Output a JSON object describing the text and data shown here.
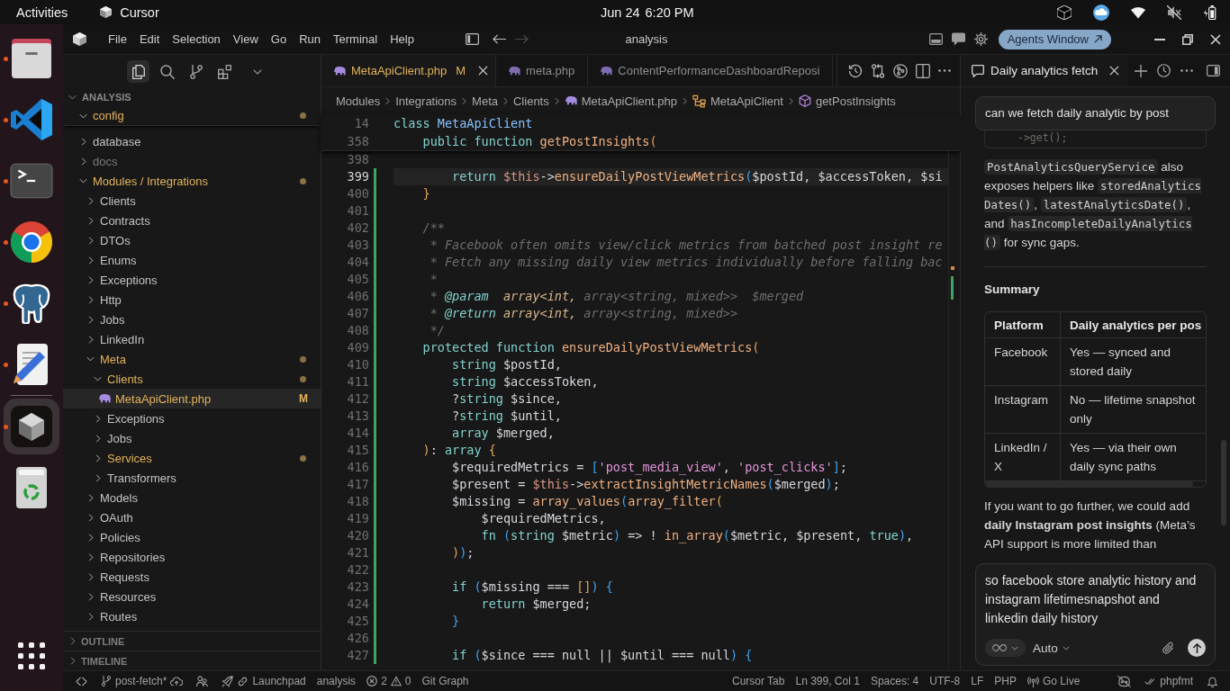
{
  "top_bar": {
    "activities": "Activities",
    "app": "Cursor",
    "date": "Jun 24",
    "time": "6:20 PM"
  },
  "dock": {
    "groups": [
      {
        "apps": [
          {
            "kind": "files",
            "running": true,
            "selected": false
          },
          {
            "kind": "code",
            "running": true,
            "selected": false
          },
          {
            "kind": "terminal",
            "running": true,
            "selected": false
          },
          {
            "kind": "browser",
            "running": true,
            "selected": false
          },
          {
            "kind": "database",
            "running": true,
            "selected": false
          },
          {
            "kind": "notes",
            "running": true,
            "selected": false
          }
        ]
      },
      {
        "apps": [
          {
            "kind": "agent",
            "running": true,
            "selected": true
          },
          {
            "kind": "trash",
            "running": false,
            "selected": false
          }
        ]
      }
    ]
  },
  "window": {
    "menu": [
      "File",
      "Edit",
      "Selection",
      "View",
      "Go",
      "Run",
      "Terminal",
      "Help"
    ],
    "title": "analysis",
    "agents_button": "Agents Window"
  },
  "activity_bar": [
    {
      "kind": "explorer",
      "selected": true
    },
    {
      "kind": "search",
      "selected": false
    },
    {
      "kind": "scm",
      "selected": false
    },
    {
      "kind": "extensions",
      "selected": false
    }
  ],
  "explorer": {
    "workspace": "ANALYSIS",
    "expanded": true,
    "tree": [
      {
        "label": "config",
        "kind": "folder",
        "expanded": true,
        "modified": true,
        "ignored": false,
        "selected": false
      },
      {
        "label": "database",
        "kind": "folder",
        "expanded": false,
        "modified": false,
        "ignored": false,
        "selected": false
      },
      {
        "label": "docs",
        "kind": "folder",
        "expanded": false,
        "modified": false,
        "ignored": true,
        "selected": false
      },
      {
        "label": "Modules / Integrations",
        "kind": "folder",
        "expanded": true,
        "modified": true,
        "ignored": false,
        "selected": false,
        "children": [
          {
            "label": "Clients",
            "kind": "folder",
            "expanded": false,
            "modified": false,
            "ignored": false,
            "selected": false
          },
          {
            "label": "Contracts",
            "kind": "folder",
            "expanded": false,
            "modified": false,
            "ignored": false,
            "selected": false
          },
          {
            "label": "DTOs",
            "kind": "folder",
            "expanded": false,
            "modified": false,
            "ignored": false,
            "selected": false
          },
          {
            "label": "Enums",
            "kind": "folder",
            "expanded": false,
            "modified": false,
            "ignored": false,
            "selected": false
          },
          {
            "label": "Exceptions",
            "kind": "folder",
            "expanded": false,
            "modified": false,
            "ignored": false,
            "selected": false
          },
          {
            "label": "Http",
            "kind": "folder",
            "expanded": false,
            "modified": false,
            "ignored": false,
            "selected": false
          },
          {
            "label": "Jobs",
            "kind": "folder",
            "expanded": false,
            "modified": false,
            "ignored": false,
            "selected": false
          },
          {
            "label": "LinkedIn",
            "kind": "folder",
            "expanded": false,
            "modified": false,
            "ignored": false,
            "selected": false
          },
          {
            "label": "Meta",
            "kind": "folder",
            "expanded": true,
            "modified": true,
            "ignored": false,
            "selected": false,
            "children": [
              {
                "label": "Clients",
                "kind": "folder",
                "expanded": true,
                "modified": true,
                "ignored": false,
                "selected": false,
                "children": [
                  {
                    "label": "MetaApiClient.php",
                    "kind": "file",
                    "modified": true,
                    "ignored": false,
                    "badge": "M",
                    "selected": true
                  }
                ]
              },
              {
                "label": "Exceptions",
                "kind": "folder",
                "expanded": false,
                "modified": false,
                "ignored": false,
                "selected": false
              },
              {
                "label": "Jobs",
                "kind": "folder",
                "expanded": false,
                "modified": false,
                "ignored": false,
                "selected": false
              },
              {
                "label": "Services",
                "kind": "folder",
                "expanded": false,
                "modified": true,
                "ignored": false,
                "selected": false
              },
              {
                "label": "Transformers",
                "kind": "folder",
                "expanded": false,
                "modified": false,
                "ignored": false,
                "selected": false
              }
            ]
          },
          {
            "label": "Models",
            "kind": "folder",
            "expanded": false,
            "modified": false,
            "ignored": false,
            "selected": false
          },
          {
            "label": "OAuth",
            "kind": "folder",
            "expanded": false,
            "modified": false,
            "ignored": false,
            "selected": false
          },
          {
            "label": "Policies",
            "kind": "folder",
            "expanded": false,
            "modified": false,
            "ignored": false,
            "selected": false
          },
          {
            "label": "Repositories",
            "kind": "folder",
            "expanded": false,
            "modified": false,
            "ignored": false,
            "selected": false
          },
          {
            "label": "Requests",
            "kind": "folder",
            "expanded": false,
            "modified": false,
            "ignored": false,
            "selected": false
          },
          {
            "label": "Resources",
            "kind": "folder",
            "expanded": false,
            "modified": false,
            "ignored": false,
            "selected": false
          },
          {
            "label": "Routes",
            "kind": "folder",
            "expanded": false,
            "modified": false,
            "ignored": false,
            "selected": false
          }
        ]
      }
    ],
    "sections": [
      {
        "label": "OUTLINE",
        "expanded": false
      },
      {
        "label": "TIMELINE",
        "expanded": false
      }
    ]
  },
  "editor": {
    "tabs": [
      {
        "label": "MetaApiClient.php",
        "modified": true,
        "badge": "M",
        "selected": true
      },
      {
        "label": "meta.php",
        "modified": false,
        "selected": false
      },
      {
        "label": "ContentPerformanceDashboardReposi",
        "modified": false,
        "selected": false
      }
    ],
    "breadcrumb": [
      {
        "label": "Modules",
        "kind": "folder"
      },
      {
        "label": "Integrations",
        "kind": "folder"
      },
      {
        "label": "Meta",
        "kind": "folder"
      },
      {
        "label": "Clients",
        "kind": "folder"
      },
      {
        "label": "MetaApiClient.php",
        "kind": "file"
      },
      {
        "label": "MetaApiClient",
        "kind": "class"
      },
      {
        "label": "getPostInsights",
        "kind": "method"
      }
    ],
    "sticky_lines": [
      {
        "number": "14",
        "tokens": [
          {
            "text": "class ",
            "kind": "keyword"
          },
          {
            "text": "MetaApiClient",
            "kind": "class"
          }
        ]
      },
      {
        "number": "358",
        "tokens": [
          {
            "text": "    public function ",
            "kind": "keyword"
          },
          {
            "text": "getPostInsights",
            "kind": "function"
          },
          {
            "text": "(",
            "kind": "bracket1"
          }
        ]
      }
    ],
    "lines": [
      {
        "number": "398",
        "changed": false,
        "current": false
      },
      {
        "number": "399",
        "changed": true,
        "current": true,
        "tokens": [
          {
            "text": "        return ",
            "kind": "keyword"
          },
          {
            "text": "$this",
            "kind": "this"
          },
          {
            "text": "->",
            "kind": "plain"
          },
          {
            "text": "ensureDailyPostViewMetrics",
            "kind": "function"
          },
          {
            "text": "(",
            "kind": "bracket2"
          },
          {
            "text": "$postId, $accessToken, $si",
            "kind": "plain"
          }
        ]
      },
      {
        "number": "400",
        "changed": true,
        "current": false,
        "tokens": [
          {
            "text": "    }",
            "kind": "bracket1"
          }
        ]
      },
      {
        "number": "401",
        "changed": true,
        "current": false
      },
      {
        "number": "402",
        "changed": true,
        "current": false,
        "tokens": [
          {
            "text": "    /**",
            "kind": "comment"
          }
        ]
      },
      {
        "number": "403",
        "changed": true,
        "current": false,
        "tokens": [
          {
            "text": "     * Facebook often omits view/click metrics from batched post insight re",
            "kind": "comment"
          }
        ]
      },
      {
        "number": "404",
        "changed": true,
        "current": false,
        "tokens": [
          {
            "text": "     * Fetch any missing daily view metrics individually before falling bac",
            "kind": "comment"
          }
        ]
      },
      {
        "number": "405",
        "changed": true,
        "current": false,
        "tokens": [
          {
            "text": "     *",
            "kind": "comment"
          }
        ]
      },
      {
        "number": "406",
        "changed": true,
        "current": false,
        "tokens": [
          {
            "text": "     * ",
            "kind": "comment"
          },
          {
            "text": "@param",
            "kind": "doctag"
          },
          {
            "text": "  array<int,",
            "kind": "doctype"
          },
          {
            "text": " array<string, mixed>>  $merged",
            "kind": "comment"
          }
        ]
      },
      {
        "number": "407",
        "changed": true,
        "current": false,
        "tokens": [
          {
            "text": "     * ",
            "kind": "comment"
          },
          {
            "text": "@return",
            "kind": "doctag"
          },
          {
            "text": " array<int,",
            "kind": "doctype"
          },
          {
            "text": " array<string, mixed>>",
            "kind": "comment"
          }
        ]
      },
      {
        "number": "408",
        "changed": true,
        "current": false,
        "tokens": [
          {
            "text": "     */",
            "kind": "comment"
          }
        ]
      },
      {
        "number": "409",
        "changed": true,
        "current": false,
        "tokens": [
          {
            "text": "    protected function ",
            "kind": "keyword"
          },
          {
            "text": "ensureDailyPostViewMetrics",
            "kind": "function"
          },
          {
            "text": "(",
            "kind": "bracket1"
          }
        ]
      },
      {
        "number": "410",
        "changed": true,
        "current": false,
        "tokens": [
          {
            "text": "        string ",
            "kind": "keyword"
          },
          {
            "text": "$postId,",
            "kind": "plain"
          }
        ]
      },
      {
        "number": "411",
        "changed": true,
        "current": false,
        "tokens": [
          {
            "text": "        string ",
            "kind": "keyword"
          },
          {
            "text": "$accessToken,",
            "kind": "plain"
          }
        ]
      },
      {
        "number": "412",
        "changed": true,
        "current": false,
        "tokens": [
          {
            "text": "        ?",
            "kind": "plain"
          },
          {
            "text": "string ",
            "kind": "keyword"
          },
          {
            "text": "$since,",
            "kind": "plain"
          }
        ]
      },
      {
        "number": "413",
        "changed": true,
        "current": false,
        "tokens": [
          {
            "text": "        ?",
            "kind": "plain"
          },
          {
            "text": "string ",
            "kind": "keyword"
          },
          {
            "text": "$until,",
            "kind": "plain"
          }
        ]
      },
      {
        "number": "414",
        "changed": true,
        "current": false,
        "tokens": [
          {
            "text": "        array ",
            "kind": "keyword"
          },
          {
            "text": "$merged,",
            "kind": "plain"
          }
        ]
      },
      {
        "number": "415",
        "changed": true,
        "current": false,
        "tokens": [
          {
            "text": "    )",
            "kind": "bracket1"
          },
          {
            "text": ": ",
            "kind": "plain"
          },
          {
            "text": "array ",
            "kind": "keyword"
          },
          {
            "text": "{",
            "kind": "bracket1"
          }
        ]
      },
      {
        "number": "416",
        "changed": true,
        "current": false,
        "tokens": [
          {
            "text": "        $requiredMetrics = ",
            "kind": "plain"
          },
          {
            "text": "[",
            "kind": "bracket2"
          },
          {
            "text": "'post_media_view'",
            "kind": "string"
          },
          {
            "text": ", ",
            "kind": "plain"
          },
          {
            "text": "'post_clicks'",
            "kind": "string"
          },
          {
            "text": "]",
            "kind": "bracket2"
          },
          {
            "text": ";",
            "kind": "plain"
          }
        ]
      },
      {
        "number": "417",
        "changed": true,
        "current": false,
        "tokens": [
          {
            "text": "        $present = ",
            "kind": "plain"
          },
          {
            "text": "$this",
            "kind": "this"
          },
          {
            "text": "->",
            "kind": "plain"
          },
          {
            "text": "extractInsightMetricNames",
            "kind": "function"
          },
          {
            "text": "(",
            "kind": "bracket2"
          },
          {
            "text": "$merged",
            "kind": "plain"
          },
          {
            "text": ")",
            "kind": "bracket2"
          },
          {
            "text": ";",
            "kind": "plain"
          }
        ]
      },
      {
        "number": "418",
        "changed": true,
        "current": false,
        "tokens": [
          {
            "text": "        $missing = ",
            "kind": "plain"
          },
          {
            "text": "array_values",
            "kind": "function"
          },
          {
            "text": "(",
            "kind": "bracket2"
          },
          {
            "text": "array_filter",
            "kind": "function"
          },
          {
            "text": "(",
            "kind": "bracket1"
          }
        ]
      },
      {
        "number": "419",
        "changed": true,
        "current": false,
        "tokens": [
          {
            "text": "            $requiredMetrics,",
            "kind": "plain"
          }
        ]
      },
      {
        "number": "420",
        "changed": true,
        "current": false,
        "tokens": [
          {
            "text": "            fn ",
            "kind": "keyword"
          },
          {
            "text": "(",
            "kind": "bracket2"
          },
          {
            "text": "string ",
            "kind": "keyword"
          },
          {
            "text": "$metric",
            "kind": "plain"
          },
          {
            "text": ")",
            "kind": "bracket2"
          },
          {
            "text": " => ! ",
            "kind": "plain"
          },
          {
            "text": "in_array",
            "kind": "function"
          },
          {
            "text": "(",
            "kind": "bracket2"
          },
          {
            "text": "$metric, $present, ",
            "kind": "plain"
          },
          {
            "text": "true",
            "kind": "keyword"
          },
          {
            "text": ")",
            "kind": "bracket2"
          },
          {
            "text": ",",
            "kind": "plain"
          }
        ]
      },
      {
        "number": "421",
        "changed": true,
        "current": false,
        "tokens": [
          {
            "text": "        )",
            "kind": "bracket1"
          },
          {
            "text": ")",
            "kind": "bracket2"
          },
          {
            "text": ";",
            "kind": "plain"
          }
        ]
      },
      {
        "number": "422",
        "changed": true,
        "current": false
      },
      {
        "number": "423",
        "changed": true,
        "current": false,
        "tokens": [
          {
            "text": "        if ",
            "kind": "keyword"
          },
          {
            "text": "(",
            "kind": "bracket2"
          },
          {
            "text": "$missing === ",
            "kind": "plain"
          },
          {
            "text": "[]",
            "kind": "bracket1"
          },
          {
            "text": ")",
            "kind": "bracket2"
          },
          {
            "text": " {",
            "kind": "bracket2"
          }
        ]
      },
      {
        "number": "424",
        "changed": true,
        "current": false,
        "tokens": [
          {
            "text": "            return ",
            "kind": "keyword"
          },
          {
            "text": "$merged;",
            "kind": "plain"
          }
        ]
      },
      {
        "number": "425",
        "changed": true,
        "current": false,
        "tokens": [
          {
            "text": "        }",
            "kind": "bracket2"
          }
        ]
      },
      {
        "number": "426",
        "changed": true,
        "current": false
      },
      {
        "number": "427",
        "changed": true,
        "current": false,
        "tokens": [
          {
            "text": "        if ",
            "kind": "keyword"
          },
          {
            "text": "(",
            "kind": "bracket2"
          },
          {
            "text": "$since === null || $until === null",
            "kind": "plain"
          },
          {
            "text": ")",
            "kind": "bracket2"
          },
          {
            "text": " {",
            "kind": "bracket2"
          }
        ]
      }
    ]
  },
  "chat": {
    "tabs": [
      {
        "label": "Daily analytics fetch",
        "selected": true
      }
    ],
    "user_message": "can we fetch daily analytic by post",
    "code_tail": "->get();",
    "blocks": [
      {
        "kind": "paragraph",
        "segments": [
          {
            "kind": "code",
            "text": "PostAnalyticsQueryService"
          },
          {
            "kind": "text",
            "text": " also exposes helpers like "
          },
          {
            "kind": "code",
            "text": "storedAnalyticsDates()"
          },
          {
            "kind": "text",
            "text": ", "
          },
          {
            "kind": "code",
            "text": "latestAnalyticsDate()"
          },
          {
            "kind": "text",
            "text": ", and "
          },
          {
            "kind": "code",
            "text": "hasIncompleteDailyAnalytics()"
          },
          {
            "kind": "text",
            "text": " for sync gaps."
          }
        ]
      },
      {
        "kind": "rule"
      },
      {
        "kind": "heading",
        "text": "Summary"
      },
      {
        "kind": "table",
        "columns": [
          "Platform",
          "Daily analytics per pos"
        ],
        "rows": [
          [
            "Facebook",
            "Yes — synced and stored daily"
          ],
          [
            "Instagram",
            "No — lifetime snapshot only"
          ],
          [
            "LinkedIn / X",
            "Yes — via their own daily sync paths"
          ]
        ]
      },
      {
        "kind": "paragraph",
        "segments": [
          {
            "kind": "text",
            "text": "If you want to go further, we could add **daily Instagram post insights** (Meta’s API support is more limited than"
          }
        ]
      }
    ],
    "input": {
      "value": "so facebook store analytic history and instagram lifetimesnapshot and linkedin daily history",
      "mode": "Auto"
    }
  },
  "status_bar": {
    "left": [
      {
        "kind": "remote"
      },
      {
        "kind": "branch",
        "text": "post-fetch*"
      },
      {
        "kind": "accounts"
      },
      {
        "kind": "launchpad",
        "text": "Launchpad"
      },
      {
        "kind": "plain",
        "text": "analysis"
      },
      {
        "kind": "problems",
        "errors": "2",
        "warnings": "0"
      },
      {
        "kind": "plain",
        "text": "Git Graph"
      }
    ],
    "right": [
      {
        "kind": "plain",
        "text": "Cursor Tab"
      },
      {
        "kind": "plain",
        "text": "Ln 399, Col 1"
      },
      {
        "kind": "plain",
        "text": "Spaces: 4"
      },
      {
        "kind": "plain",
        "text": "UTF-8"
      },
      {
        "kind": "plain",
        "text": "LF"
      },
      {
        "kind": "plain",
        "text": "PHP"
      },
      {
        "kind": "live",
        "text": "Go Live"
      },
      {
        "kind": "assistant"
      },
      {
        "kind": "formatter",
        "text": "phpfmt"
      },
      {
        "kind": "notifications"
      }
    ]
  }
}
